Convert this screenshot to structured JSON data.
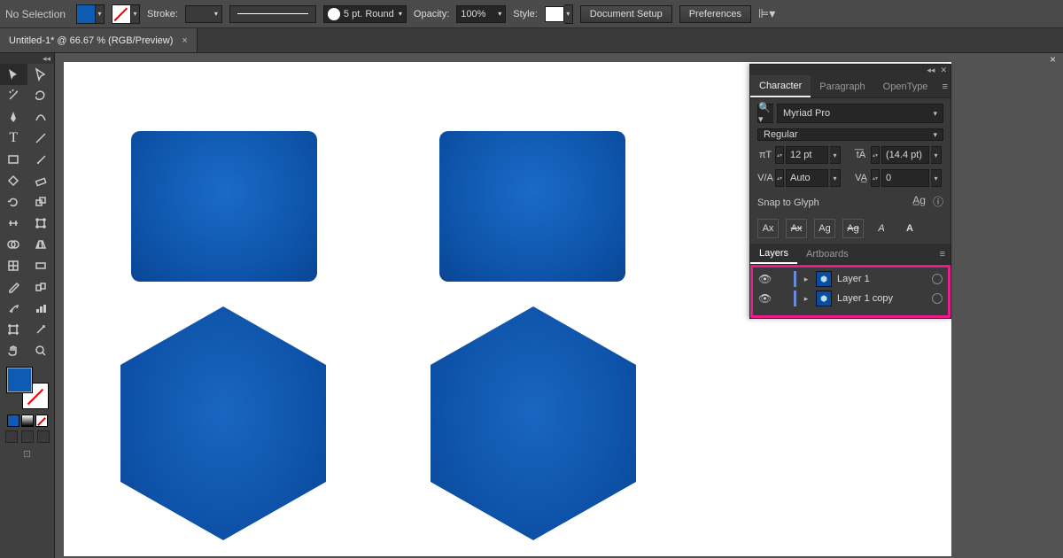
{
  "topbar": {
    "no_selection": "No Selection",
    "stroke_label": "Stroke:",
    "stroke_value": "",
    "stroke_style": "5 pt. Round",
    "opacity_label": "Opacity:",
    "opacity_value": "100%",
    "style_label": "Style:",
    "doc_setup": "Document Setup",
    "preferences": "Preferences"
  },
  "document_tab": "Untitled-1* @ 66.67 % (RGB/Preview)",
  "panels": {
    "character": {
      "tab_char": "Character",
      "tab_para": "Paragraph",
      "tab_ot": "OpenType",
      "font": "Myriad Pro",
      "weight": "Regular",
      "size": "12 pt",
      "leading": "(14.4 pt)",
      "kerning": "Auto",
      "tracking": "0",
      "snap_title": "Snap to Glyph",
      "snap": [
        "Ax",
        "Ax",
        "Ag",
        "Ag",
        "A",
        "A"
      ]
    },
    "layers": {
      "tab_layers": "Layers",
      "tab_artboards": "Artboards",
      "items": [
        {
          "name": "Layer 1"
        },
        {
          "name": "Layer 1 copy"
        }
      ]
    }
  },
  "colors": {
    "shape_fill": "#0d5bb3",
    "highlight": "#ec1a8e"
  }
}
